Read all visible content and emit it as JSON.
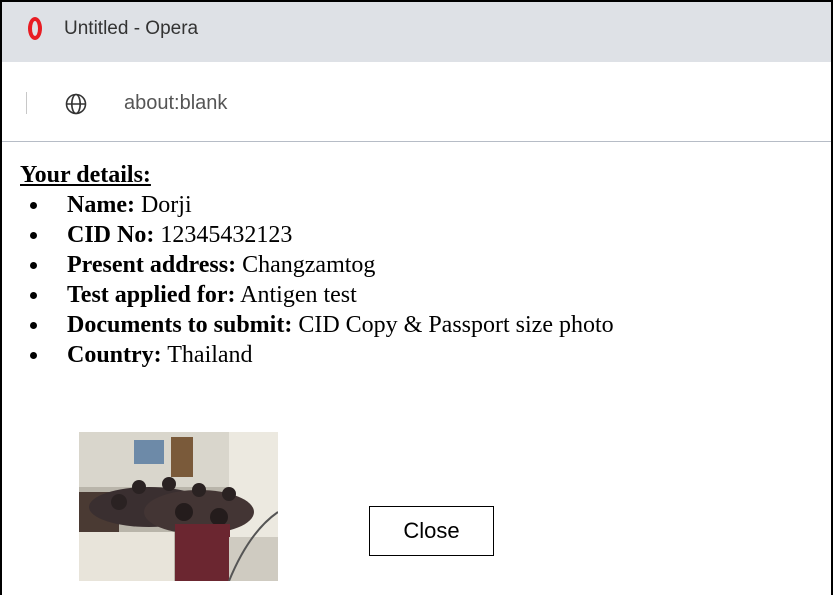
{
  "window": {
    "title": "Untitled - Opera"
  },
  "addressbar": {
    "url": "about:blank"
  },
  "details": {
    "heading": "Your details:",
    "items": [
      {
        "label": "Name:",
        "value": "Dorji"
      },
      {
        "label": "CID No:",
        "value": "12345432123"
      },
      {
        "label": "Present address:",
        "value": "Changzamtog"
      },
      {
        "label": "Test applied for:",
        "value": "Antigen test"
      },
      {
        "label": "Documents to submit:",
        "value": "CID Copy & Passport size photo"
      },
      {
        "label": "Country:",
        "value": "Thailand"
      }
    ]
  },
  "close_button": {
    "label": "Close"
  },
  "colors": {
    "titlebar_bg": "#dee1e6",
    "opera_red": "#e81c23"
  }
}
